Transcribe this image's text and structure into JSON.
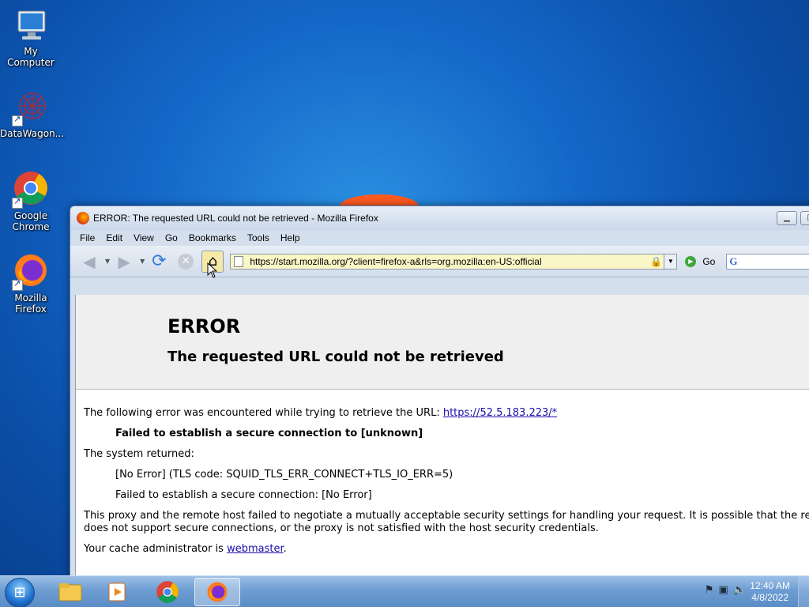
{
  "desktop": {
    "icons": [
      {
        "label": "My Computer",
        "icon": "computer-icon"
      },
      {
        "label": "DataWagon...",
        "icon": "datawagon-icon"
      },
      {
        "label": "Google Chrome",
        "icon": "chrome-icon"
      },
      {
        "label": "Mozilla Firefox",
        "icon": "firefox-icon"
      }
    ]
  },
  "window": {
    "title": "ERROR: The requested URL could not be retrieved - Mozilla Firefox",
    "menu": [
      "File",
      "Edit",
      "View",
      "Go",
      "Bookmarks",
      "Tools",
      "Help"
    ],
    "url": "https://start.mozilla.org/?client=firefox-a&rls=org.mozilla:en-US:official",
    "go_label": "Go",
    "search_engine_glyph": "G"
  },
  "page": {
    "title": "ERROR",
    "subtitle": "The requested URL could not be retrieved",
    "intro": "The following error was encountered while trying to retrieve the URL: ",
    "intro_link": "https://52.5.183.223/*",
    "failed": "Failed to establish a secure connection to [unknown]",
    "system_returned": "The system returned:",
    "tls_code": "[No Error] (TLS code: SQUID_TLS_ERR_CONNECT+TLS_IO_ERR=5)",
    "failed_conn": "Failed to establish a secure connection: [No Error]",
    "explain_1": "This proxy and the remote host failed to negotiate a mutually acceptable security settings for handling your request. It is possible that the remote",
    "explain_2": "does not support secure connections, or the proxy is not satisfied with the host security credentials.",
    "admin_prefix": "Your cache administrator is ",
    "admin_link": "webmaster",
    "admin_suffix": "."
  },
  "taskbar": {
    "time": "12:40 AM",
    "date": "4/8/2022"
  }
}
